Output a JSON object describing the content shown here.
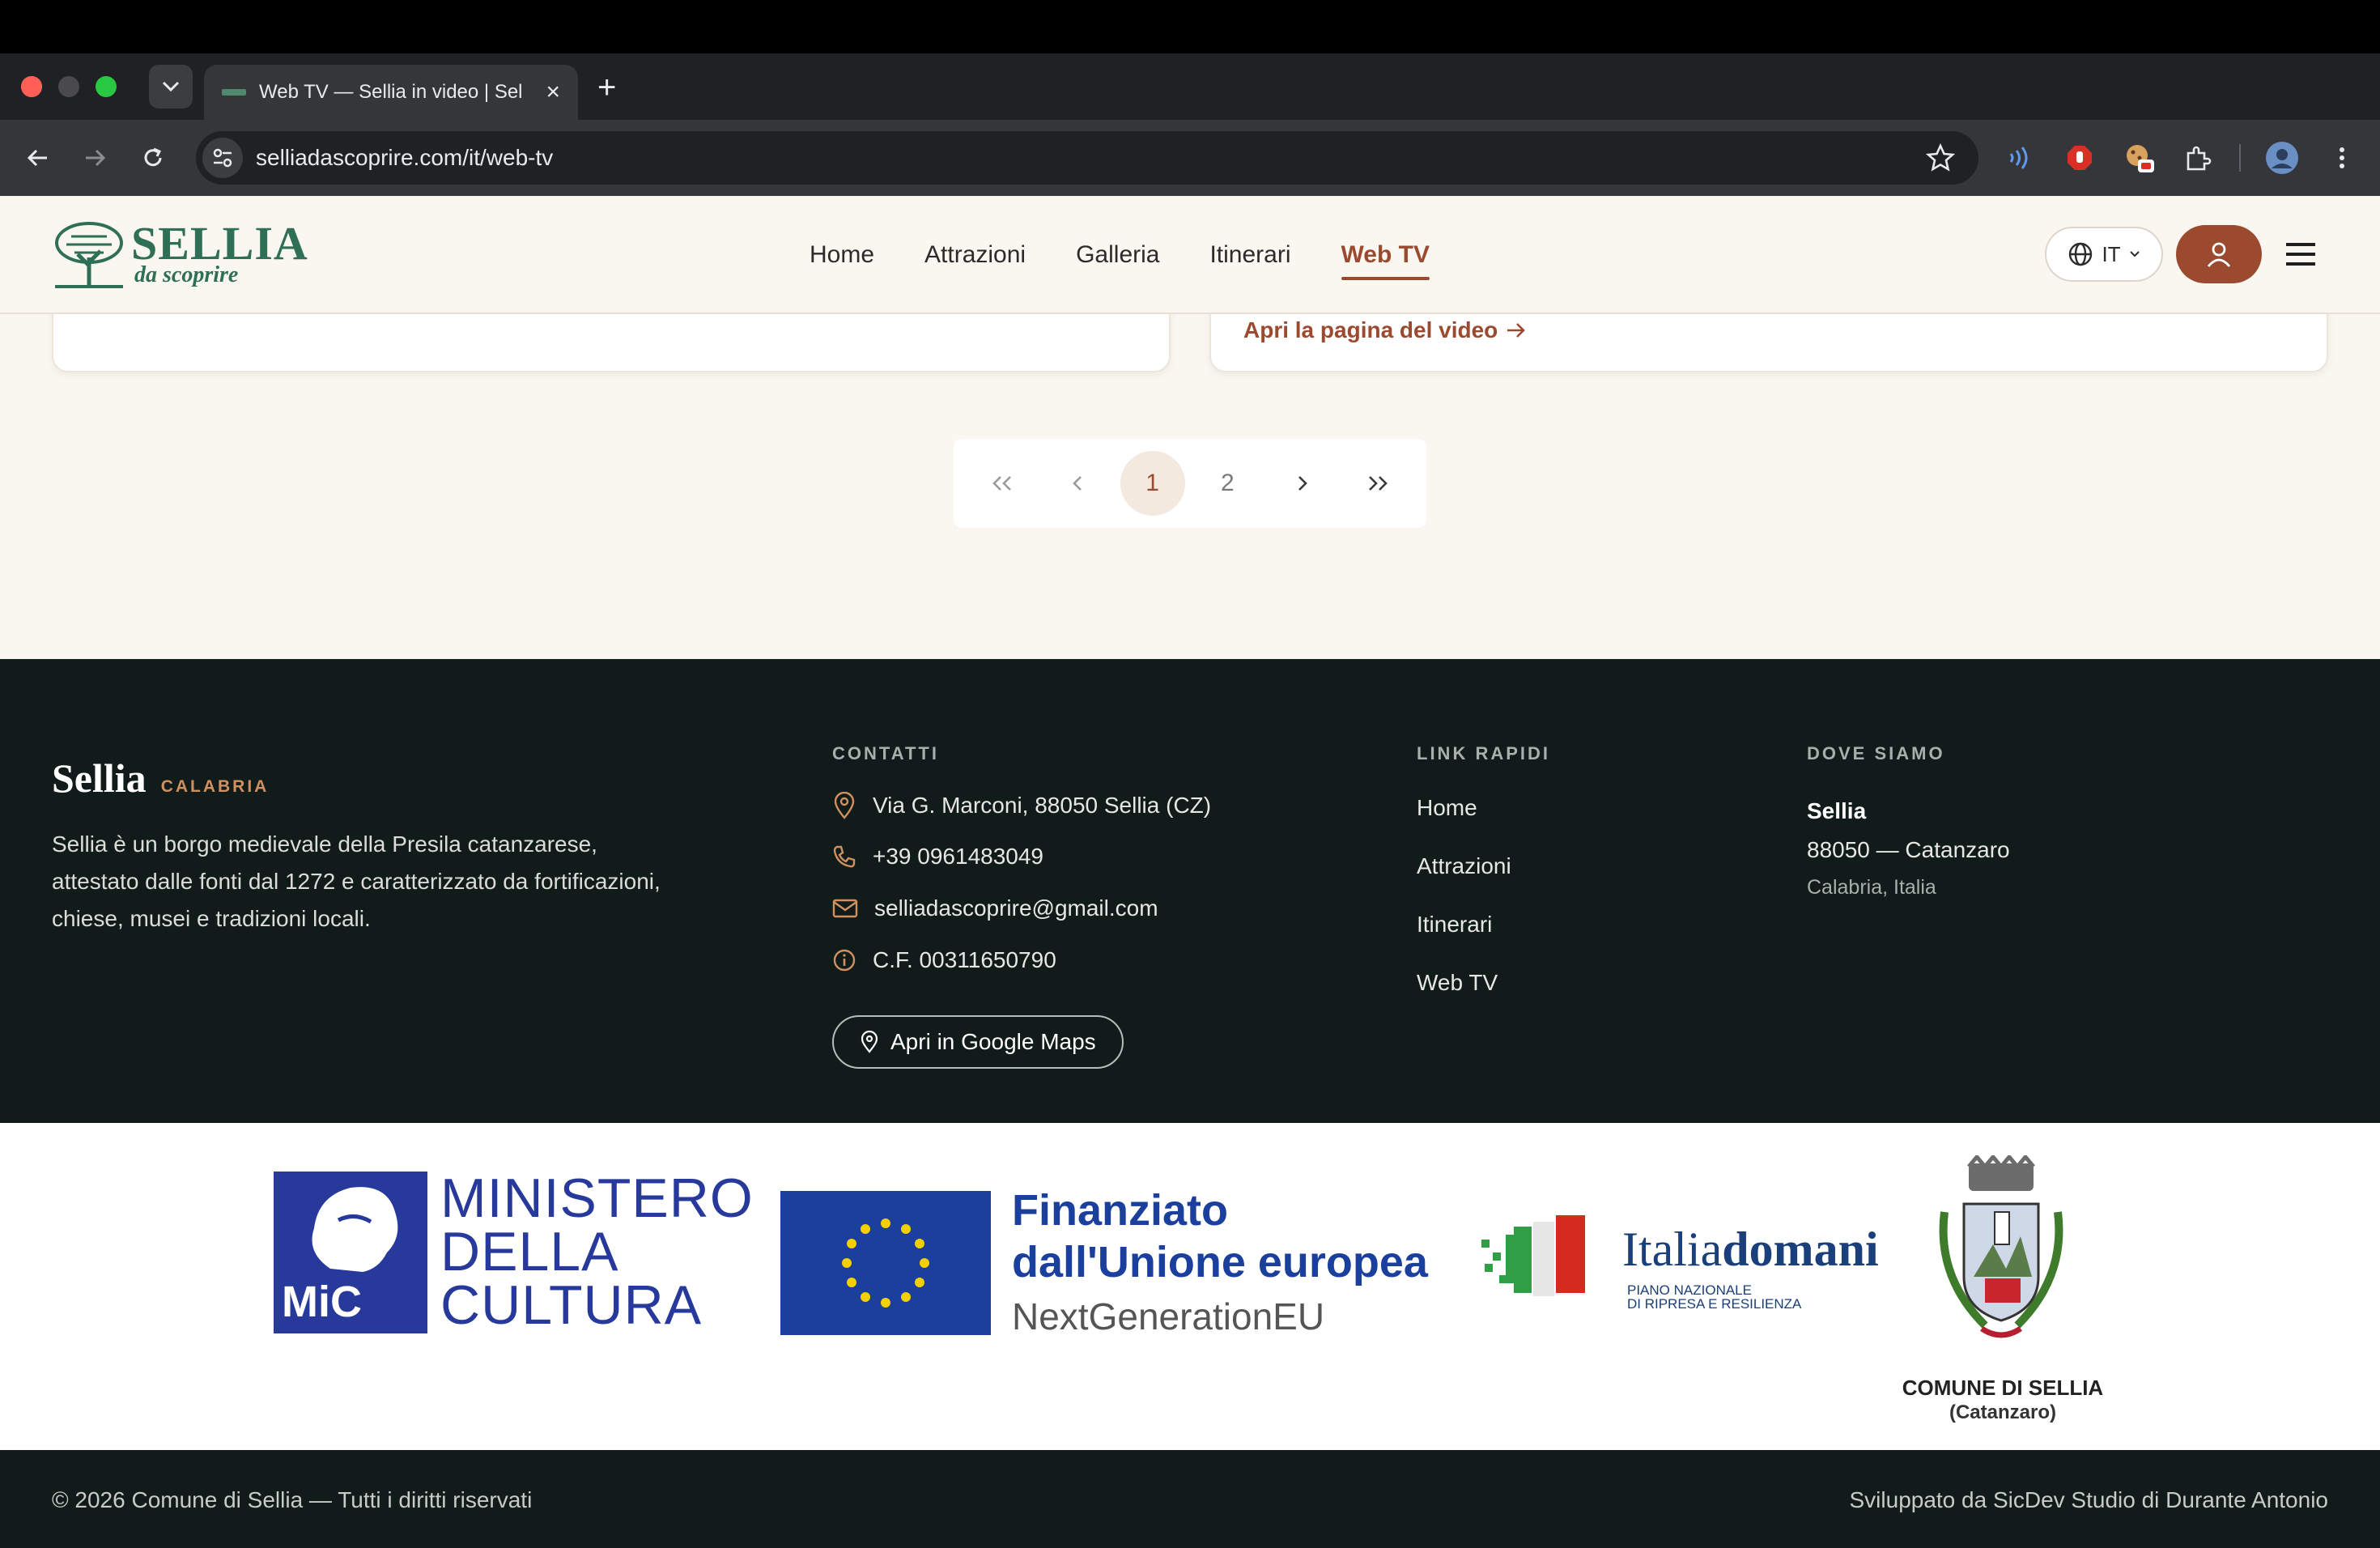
{
  "browser": {
    "tab_title": "Web TV — Sellia in video | Sel",
    "url": "selliadascoprire.com/it/web-tv"
  },
  "header": {
    "logo_word": "SELLIA",
    "logo_sub": "da scoprire",
    "nav": [
      {
        "label": "Home",
        "active": false
      },
      {
        "label": "Attrazioni",
        "active": false
      },
      {
        "label": "Galleria",
        "active": false
      },
      {
        "label": "Itinerari",
        "active": false
      },
      {
        "label": "Web TV",
        "active": true
      }
    ],
    "lang": "IT"
  },
  "content": {
    "video_link": "Apri la pagina del video",
    "pagination": {
      "current": "1",
      "pages": [
        "1",
        "2"
      ]
    }
  },
  "footer": {
    "brand": "Sellia",
    "region": "CALABRIA",
    "description": "Sellia è un borgo medievale della Presila catanzarese, attestato dalle fonti dal 1272 e caratterizzato da fortificazioni, chiese, musei e tradizioni locali.",
    "contacts_heading": "CONTATTI",
    "address": "Via G. Marconi, 88050 Sellia (CZ)",
    "phone": "+39 0961483049",
    "email": "selliadascoprire@gmail.com",
    "fiscal_code": "C.F. 00311650790",
    "maps_button": "Apri in Google Maps",
    "links_heading": "LINK RAPIDI",
    "links": [
      "Home",
      "Attrazioni",
      "Itinerari",
      "Web TV"
    ],
    "where_heading": "DOVE SIAMO",
    "where_city": "Sellia",
    "where_cap": "88050  — Catanzaro",
    "where_region": "Calabria, Italia"
  },
  "sponsors": {
    "mic_line1": "MINISTERO",
    "mic_line2": "DELLA",
    "mic_line3": "CULTURA",
    "mic_abbr": "MiC",
    "eu_line1": "Finanziato",
    "eu_line2": "dall'Unione europea",
    "eu_line3": "NextGenerationEU",
    "italia_word_a": "Italia",
    "italia_word_b": "domani",
    "italia_sub1": "PIANO NAZIONALE",
    "italia_sub2": "DI RIPRESA E RESILIENZA",
    "comune_name": "COMUNE DI SELLIA",
    "comune_prov": "(Catanzaro)"
  },
  "bottom": {
    "copyright": "© 2026 Comune di Sellia — Tutti i diritti riservati",
    "developer": "Sviluppato da SicDev Studio di Durante Antonio"
  },
  "colors": {
    "accent": "#9b4a2f",
    "brand_green": "#2f6f56",
    "footer_bg": "#111c1a",
    "page_bg": "#faf6f0"
  }
}
